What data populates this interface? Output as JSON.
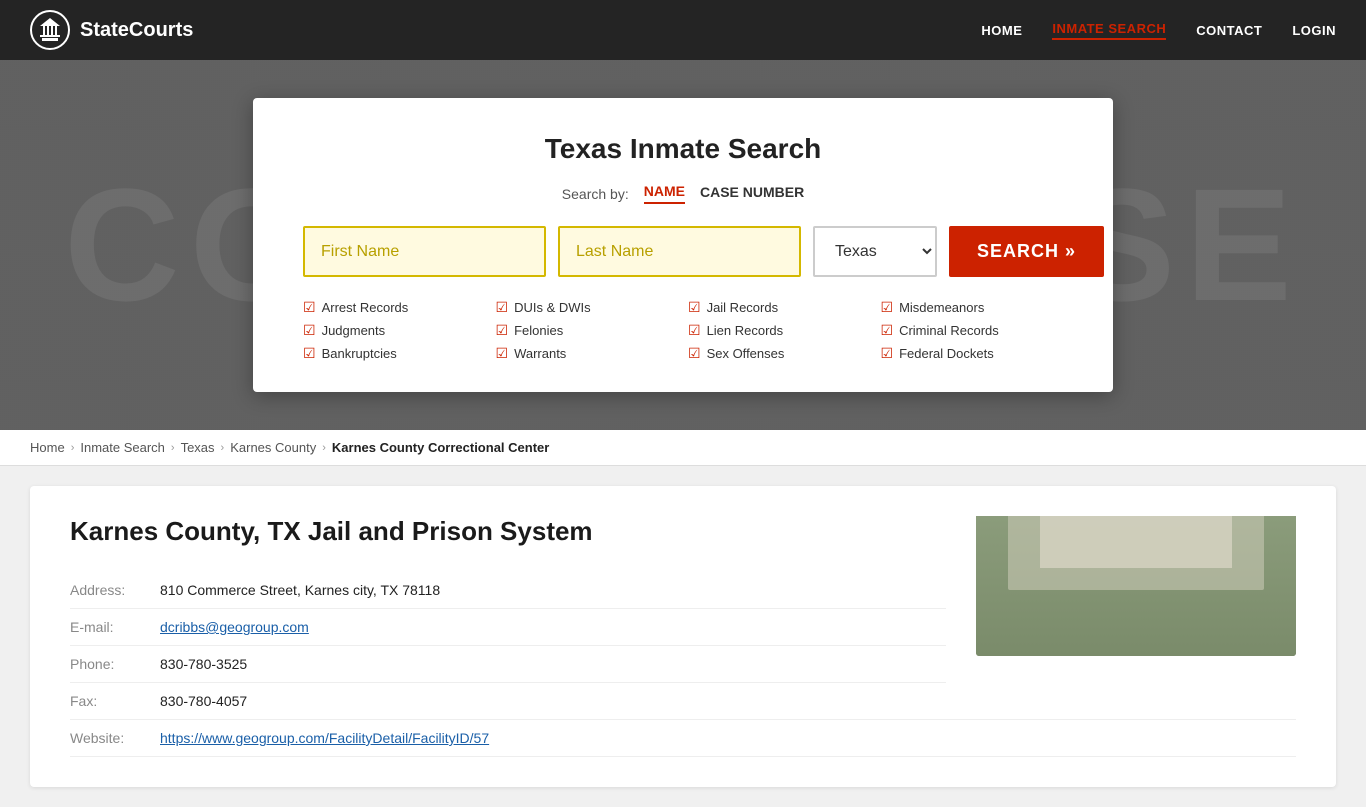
{
  "header": {
    "logo_text": "StateCourts",
    "nav_items": [
      {
        "label": "HOME",
        "active": false
      },
      {
        "label": "INMATE SEARCH",
        "active": true
      },
      {
        "label": "CONTACT",
        "active": false
      },
      {
        "label": "LOGIN",
        "active": false
      }
    ]
  },
  "hero": {
    "bg_text": "COURTHOUSE"
  },
  "search": {
    "title": "Texas Inmate Search",
    "search_by_label": "Search by:",
    "tabs": [
      {
        "label": "NAME",
        "active": true
      },
      {
        "label": "CASE NUMBER",
        "active": false
      }
    ],
    "first_name_placeholder": "First Name",
    "last_name_placeholder": "Last Name",
    "state_value": "Texas",
    "search_button_label": "SEARCH »",
    "checkboxes": [
      {
        "label": "Arrest Records"
      },
      {
        "label": "DUIs & DWIs"
      },
      {
        "label": "Jail Records"
      },
      {
        "label": "Misdemeanors"
      },
      {
        "label": "Judgments"
      },
      {
        "label": "Felonies"
      },
      {
        "label": "Lien Records"
      },
      {
        "label": "Criminal Records"
      },
      {
        "label": "Bankruptcies"
      },
      {
        "label": "Warrants"
      },
      {
        "label": "Sex Offenses"
      },
      {
        "label": "Federal Dockets"
      }
    ]
  },
  "breadcrumb": {
    "items": [
      {
        "label": "Home",
        "active": false
      },
      {
        "label": "Inmate Search",
        "active": false
      },
      {
        "label": "Texas",
        "active": false
      },
      {
        "label": "Karnes County",
        "active": false
      },
      {
        "label": "Karnes County Correctional Center",
        "active": true
      }
    ]
  },
  "facility": {
    "title": "Karnes County, TX Jail and Prison System",
    "fields": [
      {
        "label": "Address:",
        "value": "810 Commerce Street, Karnes city, TX 78118",
        "type": "text"
      },
      {
        "label": "E-mail:",
        "value": "dcribbs@geogroup.com",
        "type": "link"
      },
      {
        "label": "Phone:",
        "value": "830-780-3525",
        "type": "text"
      },
      {
        "label": "Fax:",
        "value": "830-780-4057",
        "type": "text"
      },
      {
        "label": "Website:",
        "value": "https://www.geogroup.com/FacilityDetail/FacilityID/57",
        "type": "link"
      }
    ]
  }
}
